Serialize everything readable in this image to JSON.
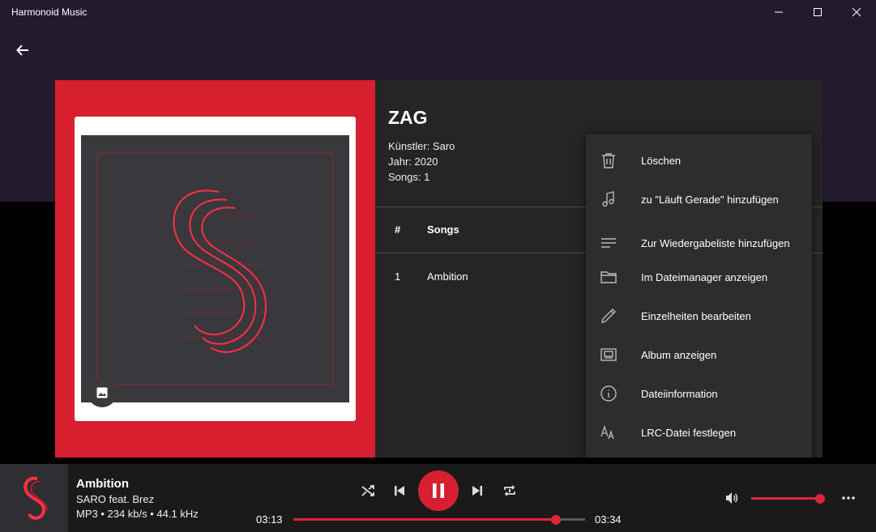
{
  "window": {
    "title": "Harmonoid Music"
  },
  "album": {
    "title": "ZAG",
    "artist_line": "Künstler: Saro",
    "year_line": "Jahr: 2020",
    "songs_line": "Songs: 1"
  },
  "table": {
    "headers": [
      "#",
      "Songs"
    ],
    "rows": [
      {
        "num": "1",
        "title": "Ambition"
      }
    ]
  },
  "context_menu": {
    "items": [
      {
        "label": "Löschen",
        "icon": "trash-icon"
      },
      {
        "label": "zu \"Läuft Gerade\" hinzufügen",
        "icon": "music-note-icon"
      },
      {
        "label": "Zur Wiedergabeliste hinzufügen",
        "icon": "playlist-add-icon"
      },
      {
        "label": "Im Dateimanager anzeigen",
        "icon": "folder-icon"
      },
      {
        "label": "Einzelheiten bearbeiten",
        "icon": "pencil-icon"
      },
      {
        "label": "Album anzeigen",
        "icon": "album-icon"
      },
      {
        "label": "Dateiinformation",
        "icon": "info-icon"
      },
      {
        "label": "LRC-Datei festlegen",
        "icon": "lyrics-icon"
      }
    ]
  },
  "now_playing": {
    "title": "Ambition",
    "artist": "SARO feat. Brez",
    "format": "MP3 • 234 kb/s • 44.1 kHz",
    "elapsed": "03:13",
    "duration": "03:34",
    "progress": 0.9,
    "volume": 1.0
  },
  "colors": {
    "accent": "#d81f2f",
    "titlebar": "#231a2d"
  }
}
